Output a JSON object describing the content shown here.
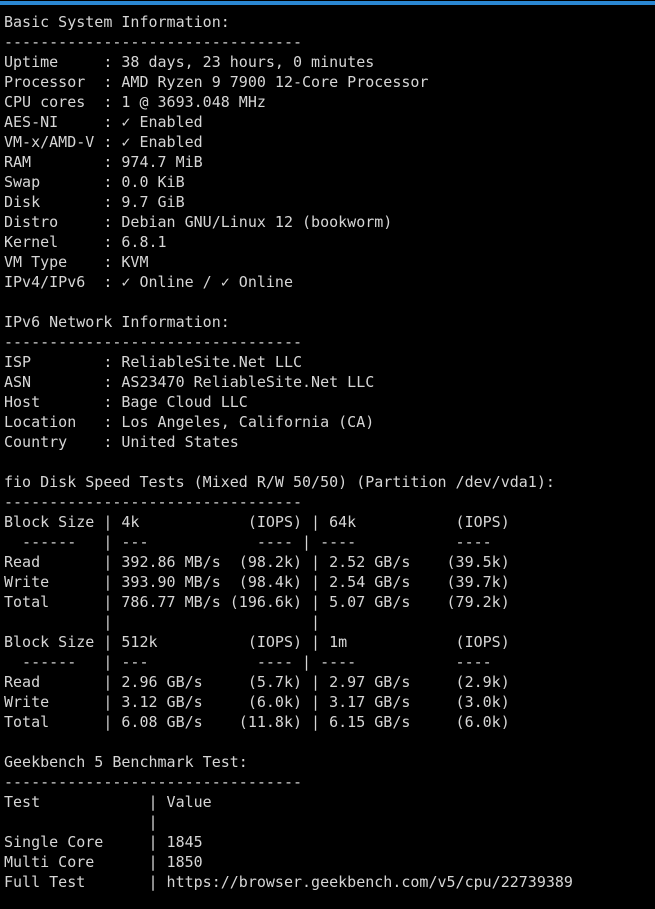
{
  "window": {
    "accent_color": "#2a87d2",
    "background_color": "#000000",
    "text_color": "#d6d6d6"
  },
  "sections": {
    "basic_system": {
      "heading": "Basic System Information:",
      "rule": "---------------------------------",
      "rows": [
        {
          "label": "Uptime",
          "value": "38 days, 23 hours, 0 minutes"
        },
        {
          "label": "Processor",
          "value": "AMD Ryzen 9 7900 12-Core Processor"
        },
        {
          "label": "CPU cores",
          "value": "1 @ 3693.048 MHz"
        },
        {
          "label": "AES-NI",
          "value": "✓ Enabled"
        },
        {
          "label": "VM-x/AMD-V",
          "value": "✓ Enabled"
        },
        {
          "label": "RAM",
          "value": "974.7 MiB"
        },
        {
          "label": "Swap",
          "value": "0.0 KiB"
        },
        {
          "label": "Disk",
          "value": "9.7 GiB"
        },
        {
          "label": "Distro",
          "value": "Debian GNU/Linux 12 (bookworm)"
        },
        {
          "label": "Kernel",
          "value": "6.8.1"
        },
        {
          "label": "VM Type",
          "value": "KVM"
        },
        {
          "label": "IPv4/IPv6",
          "value": "✓ Online / ✓ Online"
        }
      ]
    },
    "ipv6_network": {
      "heading": "IPv6 Network Information:",
      "rule": "---------------------------------",
      "rows": [
        {
          "label": "ISP",
          "value": "ReliableSite.Net LLC"
        },
        {
          "label": "ASN",
          "value": "AS23470 ReliableSite.Net LLC"
        },
        {
          "label": "Host",
          "value": "Bage Cloud LLC"
        },
        {
          "label": "Location",
          "value": "Los Angeles, California (CA)"
        },
        {
          "label": "Country",
          "value": "United States"
        }
      ]
    },
    "fio_disk": {
      "heading": "fio Disk Speed Tests (Mixed R/W 50/50) (Partition /dev/vda1):",
      "rule": "---------------------------------",
      "tables": [
        {
          "header_label": "Block Size",
          "block_a": "4k",
          "block_b": "64k",
          "iops_a": "(IOPS)",
          "iops_b": "(IOPS)",
          "dash_label": "------",
          "dash_a": "---",
          "dash_a_iops": "----",
          "dash_b": "----",
          "dash_b_iops": "----",
          "rows": [
            {
              "name": "Read",
              "speed_a": "392.86 MB/s",
              "iops_a": "(98.2k)",
              "speed_b": "2.52 GB/s",
              "iops_b": "(39.5k)"
            },
            {
              "name": "Write",
              "speed_a": "393.90 MB/s",
              "iops_a": "(98.4k)",
              "speed_b": "2.54 GB/s",
              "iops_b": "(39.7k)"
            },
            {
              "name": "Total",
              "speed_a": "786.77 MB/s",
              "iops_a": "(196.6k)",
              "speed_b": "5.07 GB/s",
              "iops_b": "(79.2k)"
            }
          ]
        },
        {
          "header_label": "Block Size",
          "block_a": "512k",
          "block_b": "1m",
          "iops_a": "(IOPS)",
          "iops_b": "(IOPS)",
          "dash_label": "------",
          "dash_a": "---",
          "dash_a_iops": "----",
          "dash_b": "----",
          "dash_b_iops": "----",
          "rows": [
            {
              "name": "Read",
              "speed_a": "2.96 GB/s",
              "iops_a": "(5.7k)",
              "speed_b": "2.97 GB/s",
              "iops_b": "(2.9k)"
            },
            {
              "name": "Write",
              "speed_a": "3.12 GB/s",
              "iops_a": "(6.0k)",
              "speed_b": "3.17 GB/s",
              "iops_b": "(3.0k)"
            },
            {
              "name": "Total",
              "speed_a": "6.08 GB/s",
              "iops_a": "(11.8k)",
              "speed_b": "6.15 GB/s",
              "iops_b": "(6.0k)"
            }
          ]
        }
      ]
    },
    "geekbench": {
      "heading": "Geekbench 5 Benchmark Test:",
      "rule": "---------------------------------",
      "col_test": "Test",
      "col_value": "Value",
      "rows": [
        {
          "name": "Single Core",
          "value": "1845"
        },
        {
          "name": "Multi Core",
          "value": "1850"
        },
        {
          "name": "Full Test",
          "value": "https://browser.geekbench.com/v5/cpu/22739389"
        }
      ]
    }
  },
  "rendered_lines": [
    "Basic System Information:",
    "---------------------------------",
    "Uptime     : 38 days, 23 hours, 0 minutes",
    "Processor  : AMD Ryzen 9 7900 12-Core Processor",
    "CPU cores  : 1 @ 3693.048 MHz",
    "AES-NI     : ✓ Enabled",
    "VM-x/AMD-V : ✓ Enabled",
    "RAM        : 974.7 MiB",
    "Swap       : 0.0 KiB",
    "Disk       : 9.7 GiB",
    "Distro     : Debian GNU/Linux 12 (bookworm)",
    "Kernel     : 6.8.1",
    "VM Type    : KVM",
    "IPv4/IPv6  : ✓ Online / ✓ Online",
    "",
    "IPv6 Network Information:",
    "---------------------------------",
    "ISP        : ReliableSite.Net LLC",
    "ASN        : AS23470 ReliableSite.Net LLC",
    "Host       : Bage Cloud LLC",
    "Location   : Los Angeles, California (CA)",
    "Country    : United States",
    "",
    "fio Disk Speed Tests (Mixed R/W 50/50) (Partition /dev/vda1):",
    "---------------------------------",
    "Block Size | 4k            (IOPS) | 64k           (IOPS)",
    "  ------   | ---            ---- | ----           ----",
    "Read       | 392.86 MB/s  (98.2k) | 2.52 GB/s    (39.5k)",
    "Write      | 393.90 MB/s  (98.4k) | 2.54 GB/s    (39.7k)",
    "Total      | 786.77 MB/s (196.6k) | 5.07 GB/s    (79.2k)",
    "           |                      |",
    "Block Size | 512k          (IOPS) | 1m            (IOPS)",
    "  ------   | ---            ---- | ----           ----",
    "Read       | 2.96 GB/s     (5.7k) | 2.97 GB/s     (2.9k)",
    "Write      | 3.12 GB/s     (6.0k) | 3.17 GB/s     (3.0k)",
    "Total      | 6.08 GB/s    (11.8k) | 6.15 GB/s     (6.0k)",
    "",
    "Geekbench 5 Benchmark Test:",
    "---------------------------------",
    "Test            | Value",
    "                |",
    "Single Core     | 1845",
    "Multi Core      | 1850",
    "Full Test       | https://browser.geekbench.com/v5/cpu/22739389"
  ]
}
